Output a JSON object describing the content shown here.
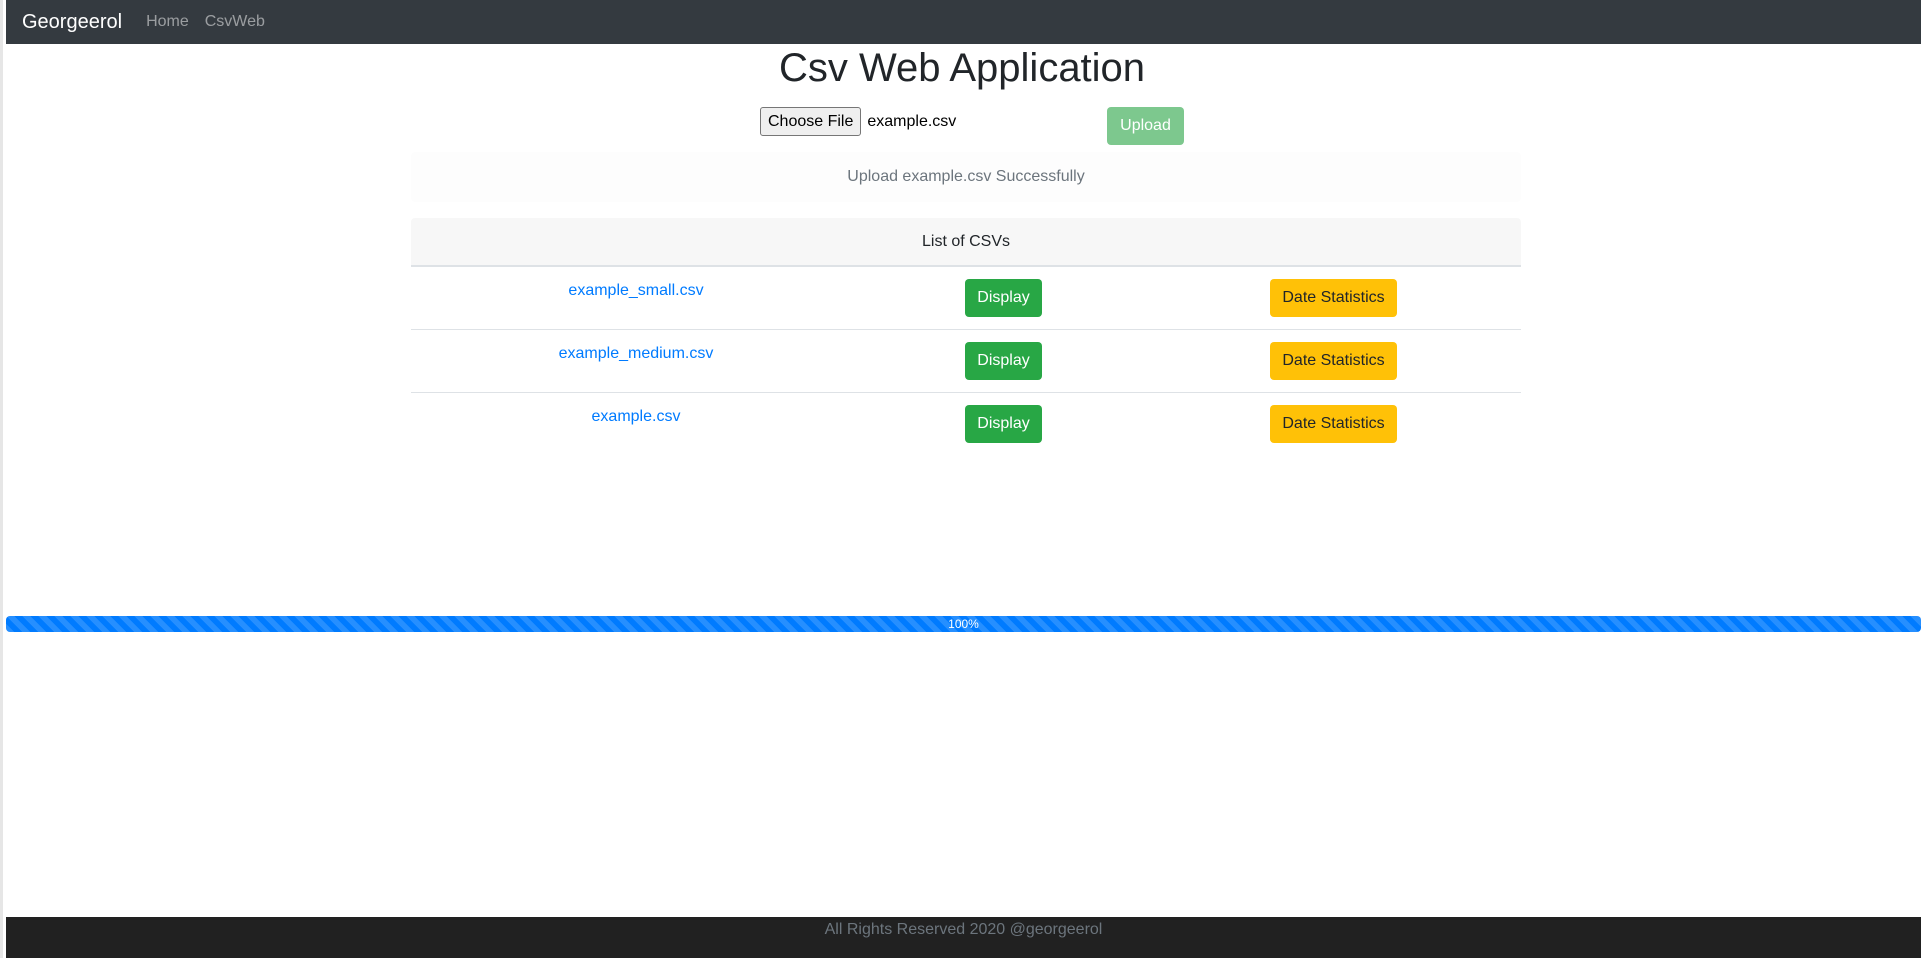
{
  "navbar": {
    "brand": "Georgeerol",
    "links": [
      {
        "label": "Home"
      },
      {
        "label": "CsvWeb"
      }
    ]
  },
  "page_title": "Csv Web Application",
  "upload": {
    "choose_file_label": "Choose File",
    "selected_file": "example.csv",
    "upload_label": "Upload"
  },
  "alert": {
    "message": "Upload example.csv Successfully"
  },
  "table": {
    "header": "List of CSVs",
    "rows": [
      {
        "file": "example_small.csv",
        "display_label": "Display",
        "stats_label": "Date Statistics"
      },
      {
        "file": "example_medium.csv",
        "display_label": "Display",
        "stats_label": "Date Statistics"
      },
      {
        "file": "example.csv",
        "display_label": "Display",
        "stats_label": "Date Statistics"
      }
    ]
  },
  "progress": {
    "value_percent": 100,
    "label": "100%"
  },
  "footer": {
    "text": "All Rights Reserved 2020 @georgeerol"
  },
  "colors": {
    "navbar": "#343a40",
    "primary": "#007bff",
    "success": "#28a745",
    "warning": "#ffc107",
    "footer": "#212121"
  }
}
